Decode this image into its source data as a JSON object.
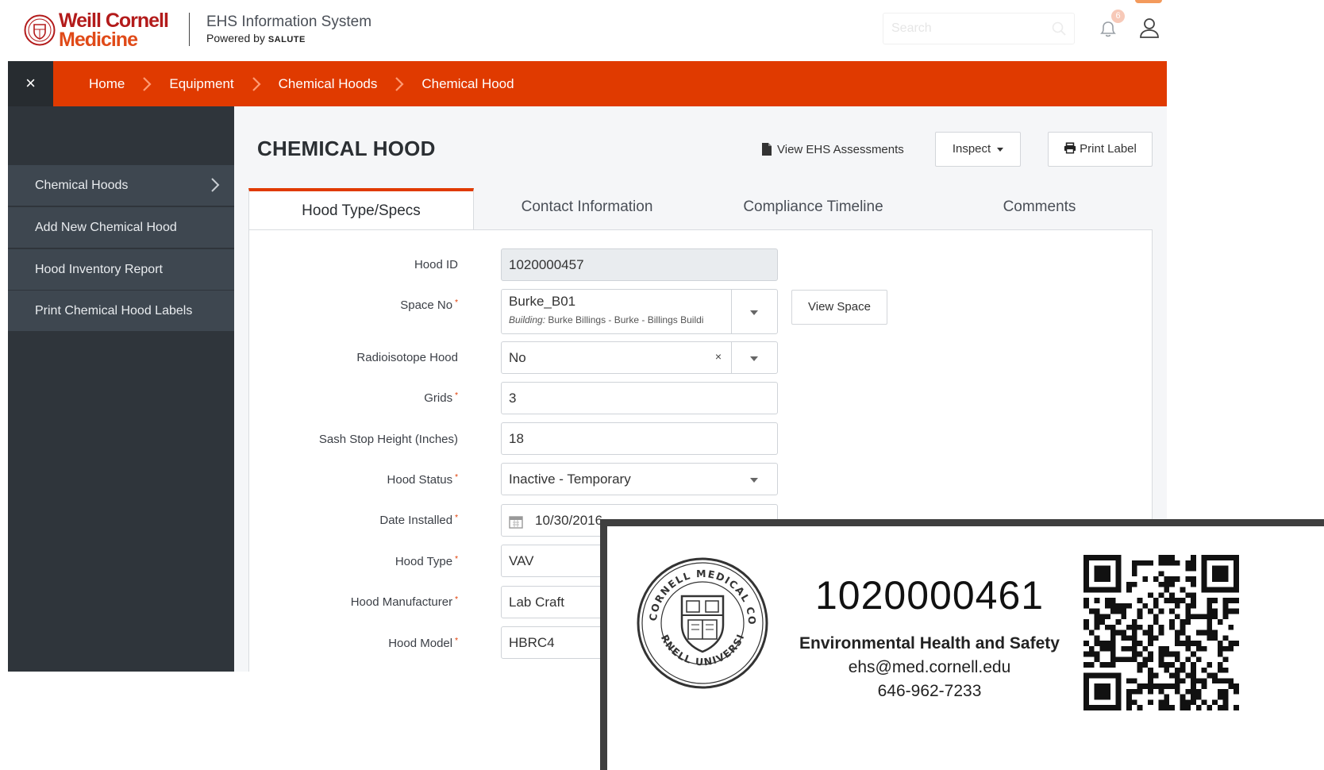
{
  "header": {
    "brand_line1": "Weill Cornell",
    "brand_line2": "Medicine",
    "system_title": "EHS Information System",
    "powered_by": "Powered by",
    "powered_brand": "SALUTE",
    "search_placeholder": "Search",
    "notification_count": "6"
  },
  "breadcrumb": {
    "close_label": "×",
    "items": [
      "Home",
      "Equipment",
      "Chemical Hoods",
      "Chemical Hood"
    ]
  },
  "sidebar": {
    "items": [
      {
        "label": "Chemical Hoods"
      },
      {
        "label": "Add New Chemical Hood"
      },
      {
        "label": "Hood Inventory Report"
      },
      {
        "label": "Print Chemical Hood Labels"
      }
    ]
  },
  "page": {
    "title": "CHEMICAL HOOD",
    "view_assessments": "View EHS Assessments",
    "inspect_button": "Inspect",
    "print_label_button": "Print Label",
    "tabs": [
      "Hood Type/Specs",
      "Contact Information",
      "Compliance Timeline",
      "Comments"
    ]
  },
  "form": {
    "hood_id": {
      "label": "Hood ID",
      "value": "1020000457"
    },
    "space_no": {
      "label": "Space No",
      "value": "Burke_B01",
      "building_label": "Building:",
      "building_value": "Burke Billings - Burke - Billings Buildi"
    },
    "view_space_button": "View Space",
    "radioisotope": {
      "label": "Radioisotope Hood",
      "value": "No",
      "clear": "×"
    },
    "grids": {
      "label": "Grids",
      "value": "3"
    },
    "sash": {
      "label": "Sash Stop Height (Inches)",
      "value": "18"
    },
    "status": {
      "label": "Hood Status",
      "value": "Inactive - Temporary"
    },
    "date_installed": {
      "label": "Date Installed",
      "value": "10/30/2016"
    },
    "hood_type": {
      "label": "Hood Type",
      "value": "VAV"
    },
    "manufacturer": {
      "label": "Hood Manufacturer",
      "value": "Lab Craft"
    },
    "model": {
      "label": "Hood Model",
      "value": "HBRC4"
    },
    "required_mark": "*"
  },
  "label_card": {
    "seal_text_top": "WEILL CORNELL MEDICAL COLLEGE",
    "seal_text_bottom": "CORNELL UNIVERSITY",
    "hood_number": "1020000461",
    "department": "Environmental Health and Safety",
    "email": "ehs@med.cornell.edu",
    "phone": "646-962-7233"
  },
  "colors": {
    "accent": "#e03a00",
    "sidebar_bg": "#2f353b",
    "sidebar_item_bg": "#3e4750",
    "brand_red": "#b31b1b"
  }
}
